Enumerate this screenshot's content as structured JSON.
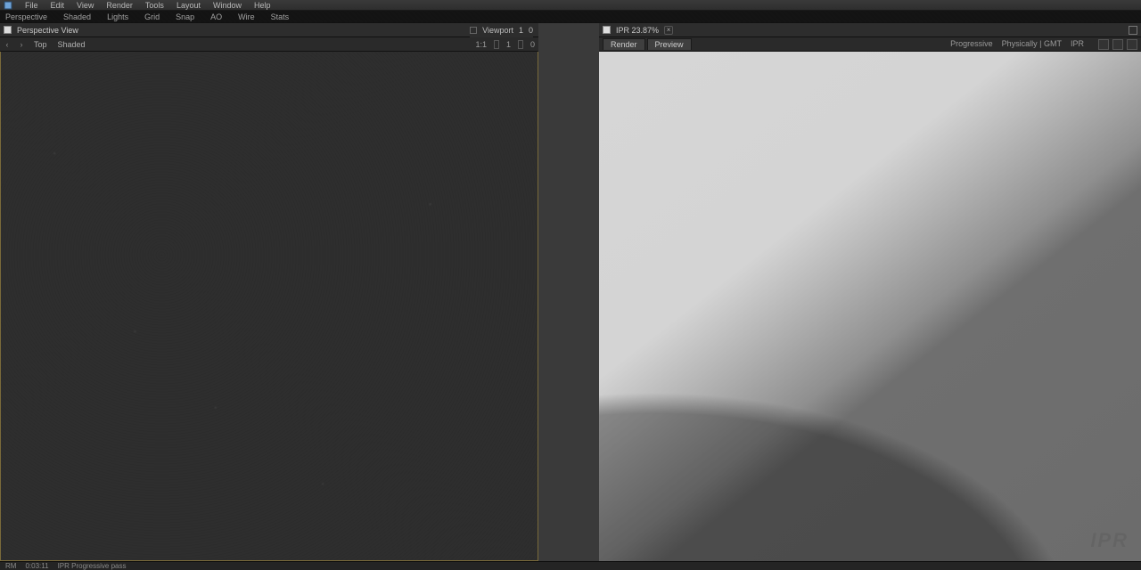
{
  "menu": {
    "items": [
      "File",
      "Edit",
      "View",
      "Render",
      "Tools",
      "Layout",
      "Window",
      "Help"
    ]
  },
  "ribbon": {
    "items": [
      "Perspective",
      "Shaded",
      "Lights",
      "Grid",
      "Snap",
      "AO",
      "Wire",
      "Stats"
    ]
  },
  "leftPane": {
    "docIcon": "document-icon",
    "title": "Perspective View",
    "crumb": {
      "label": "Viewport",
      "a": "1",
      "b": "0"
    },
    "sub": {
      "back": "‹",
      "fwd": "›",
      "seg1": "Top",
      "seg2": "Shaded",
      "mini": {
        "tag": "1:1",
        "pct": "1",
        "alt": "0"
      }
    }
  },
  "rightPane": {
    "docIcon": "document-icon",
    "title": "IPR  23.87%",
    "close": "×",
    "sub": {
      "tab1": "Render",
      "tab2": "Preview",
      "info1": "Progressive",
      "info2": "Physically | GMT",
      "rbtns": [
        "a",
        "b",
        "c"
      ],
      "rlabel": "IPR"
    }
  },
  "status": {
    "a": "RM",
    "b": "0:03:11",
    "c": "IPR  Progressive pass"
  },
  "watermark": "IPR"
}
